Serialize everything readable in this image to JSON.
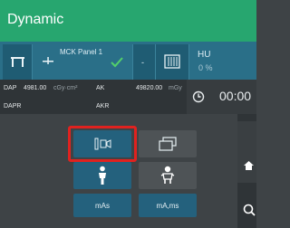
{
  "window": {
    "title": "Dynamic"
  },
  "toolbar": {
    "panel_name": "MCK Panel 1",
    "dash": "-",
    "hu_label": "HU",
    "hu_value": "0 %"
  },
  "dose": {
    "dap_label": "DAP",
    "dap_value": "4981.00",
    "dap_unit": "cGy·cm²",
    "ak_label": "AK",
    "ak_value": "49820.00",
    "ak_unit": "mGy",
    "dapr_label": "DAPR",
    "akr_label": "AKR"
  },
  "timer": {
    "value": "00:00"
  },
  "controls": {
    "mas_label": "mAs",
    "mams_label": "mA,ms"
  },
  "colors": {
    "title_green": "#27a66f",
    "toolbar_blue": "#2a6f88",
    "check_green": "#53d06a",
    "highlight_red": "#e0221f"
  }
}
